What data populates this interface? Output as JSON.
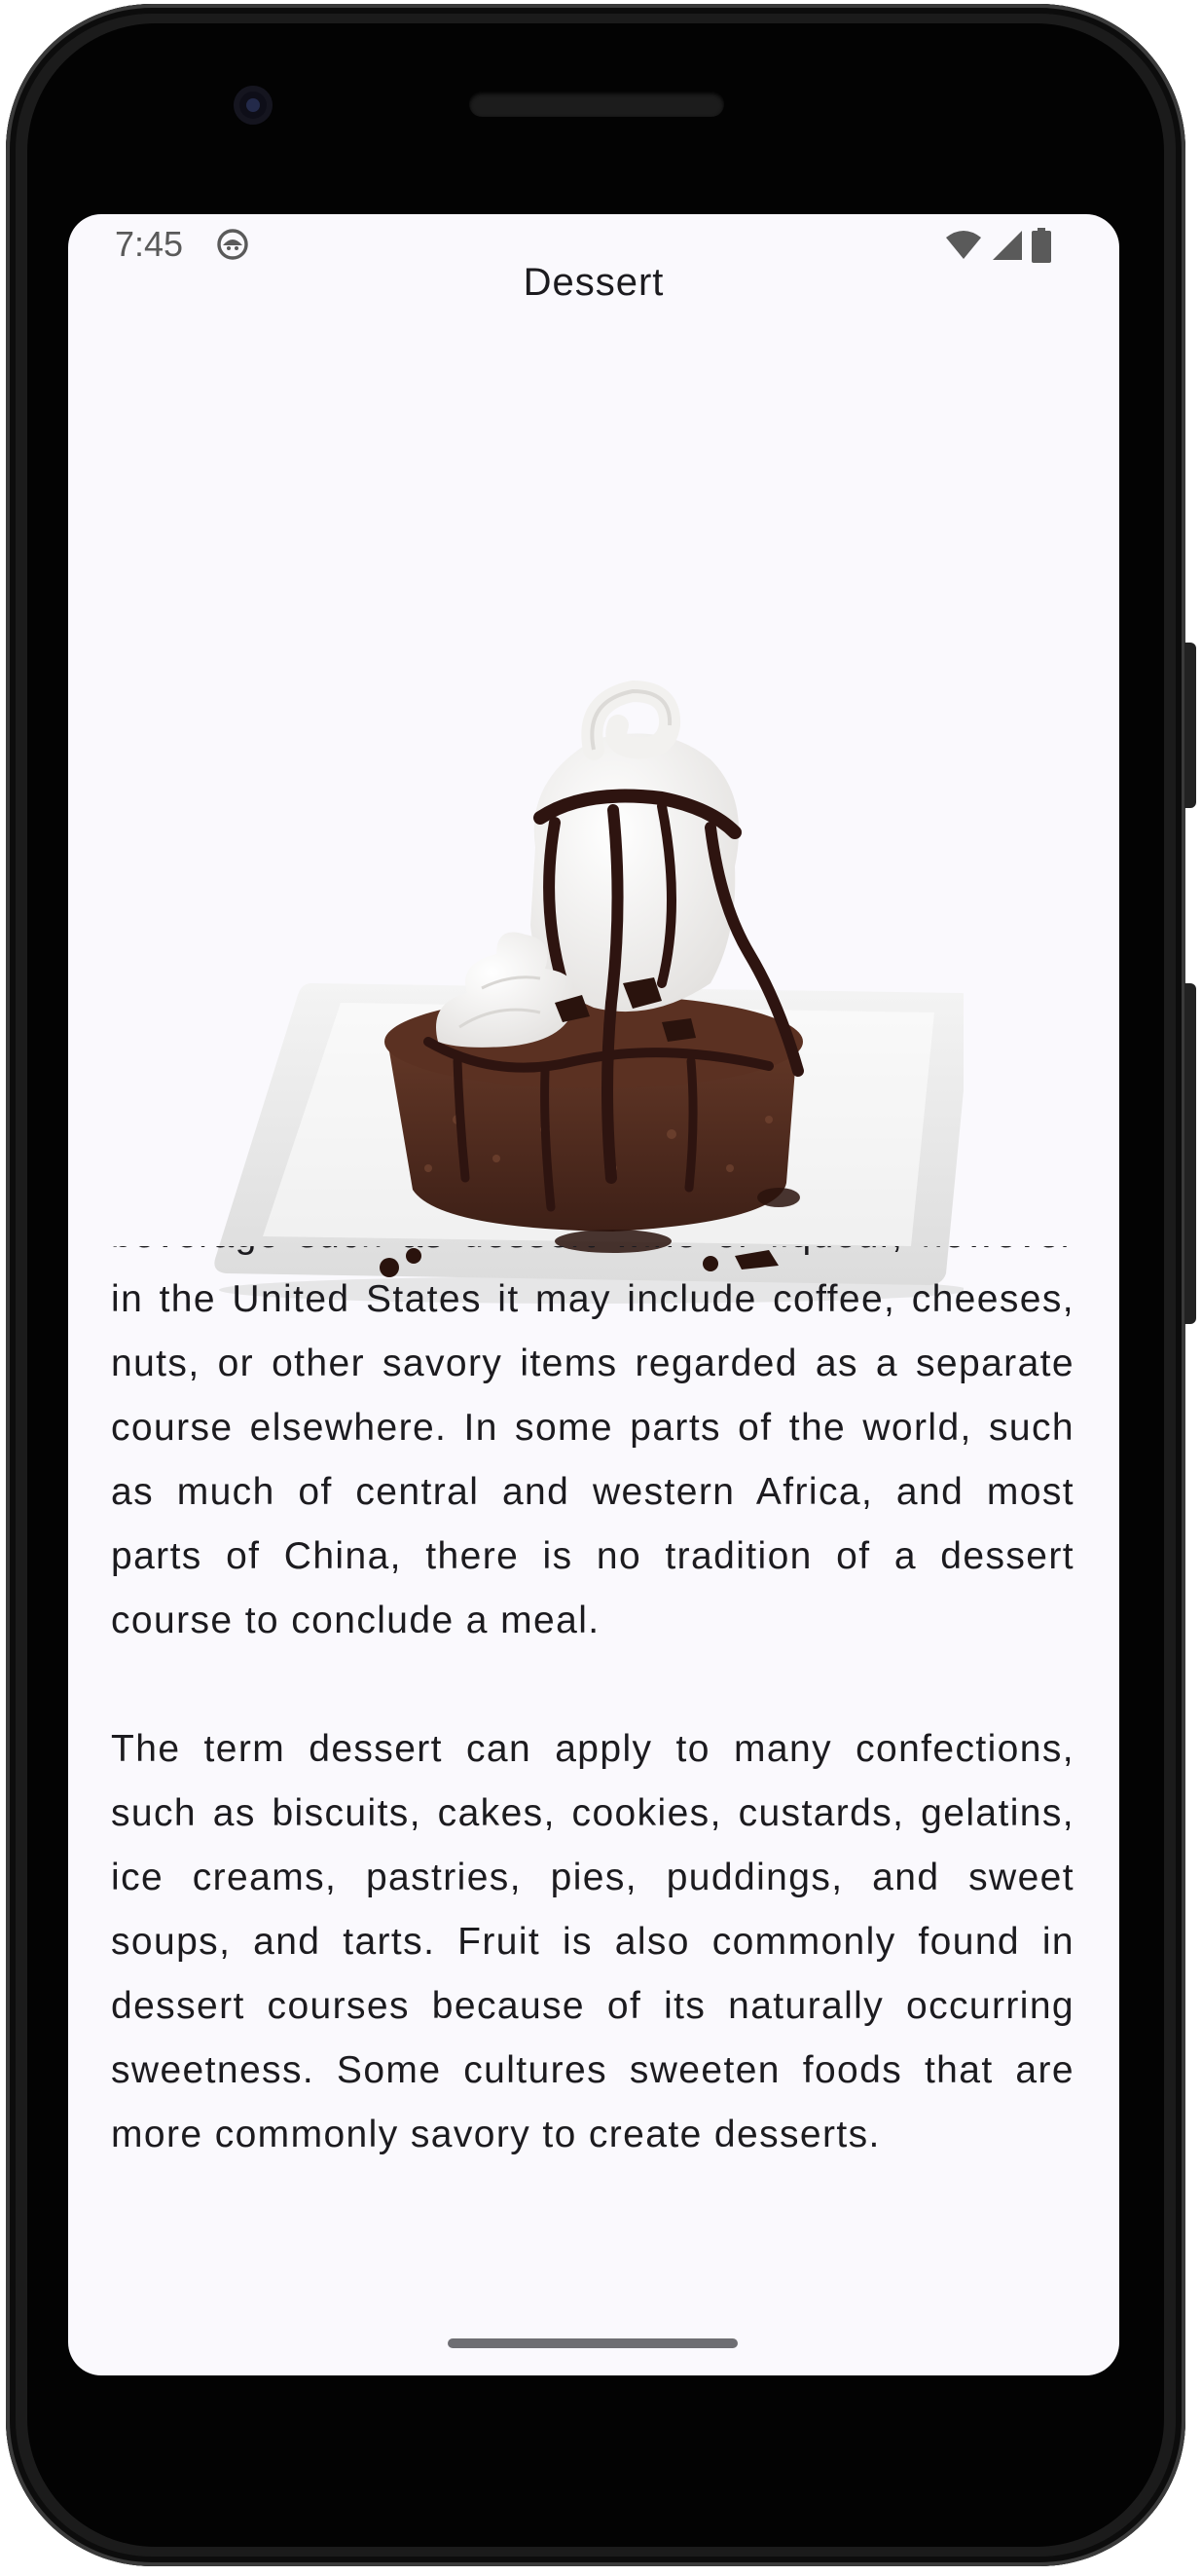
{
  "status_bar": {
    "time": "7:45",
    "app_icon": "android-app-icon",
    "icons": [
      "wifi-icon",
      "cellular-signal-icon",
      "battery-icon"
    ]
  },
  "screen": {
    "title": "Dessert",
    "image": {
      "icon": "dessert-image"
    },
    "paragraphs": [
      "beverage such as dessert wine or liqueur, however in the United States it may include coffee, cheeses, nuts, or other savory items regarded as a separate course elsewhere. In some parts of the world, such as much of central and western Africa, and most parts of China, there is no tradition of a dessert course to conclude a meal.",
      "The term dessert can apply to many confections, such as biscuits, cakes, cookies, custards, gelatins, ice creams, pastries, pies, puddings, and sweet soups, and tarts. Fruit is also commonly found in dessert courses because of its naturally occurring sweetness. Some cultures sweeten foods that are more commonly savory to create desserts."
    ]
  },
  "colors": {
    "screen_background": "#faf9fd",
    "text": "#1c1b1f",
    "phone_frame": "#1b1b1b"
  }
}
